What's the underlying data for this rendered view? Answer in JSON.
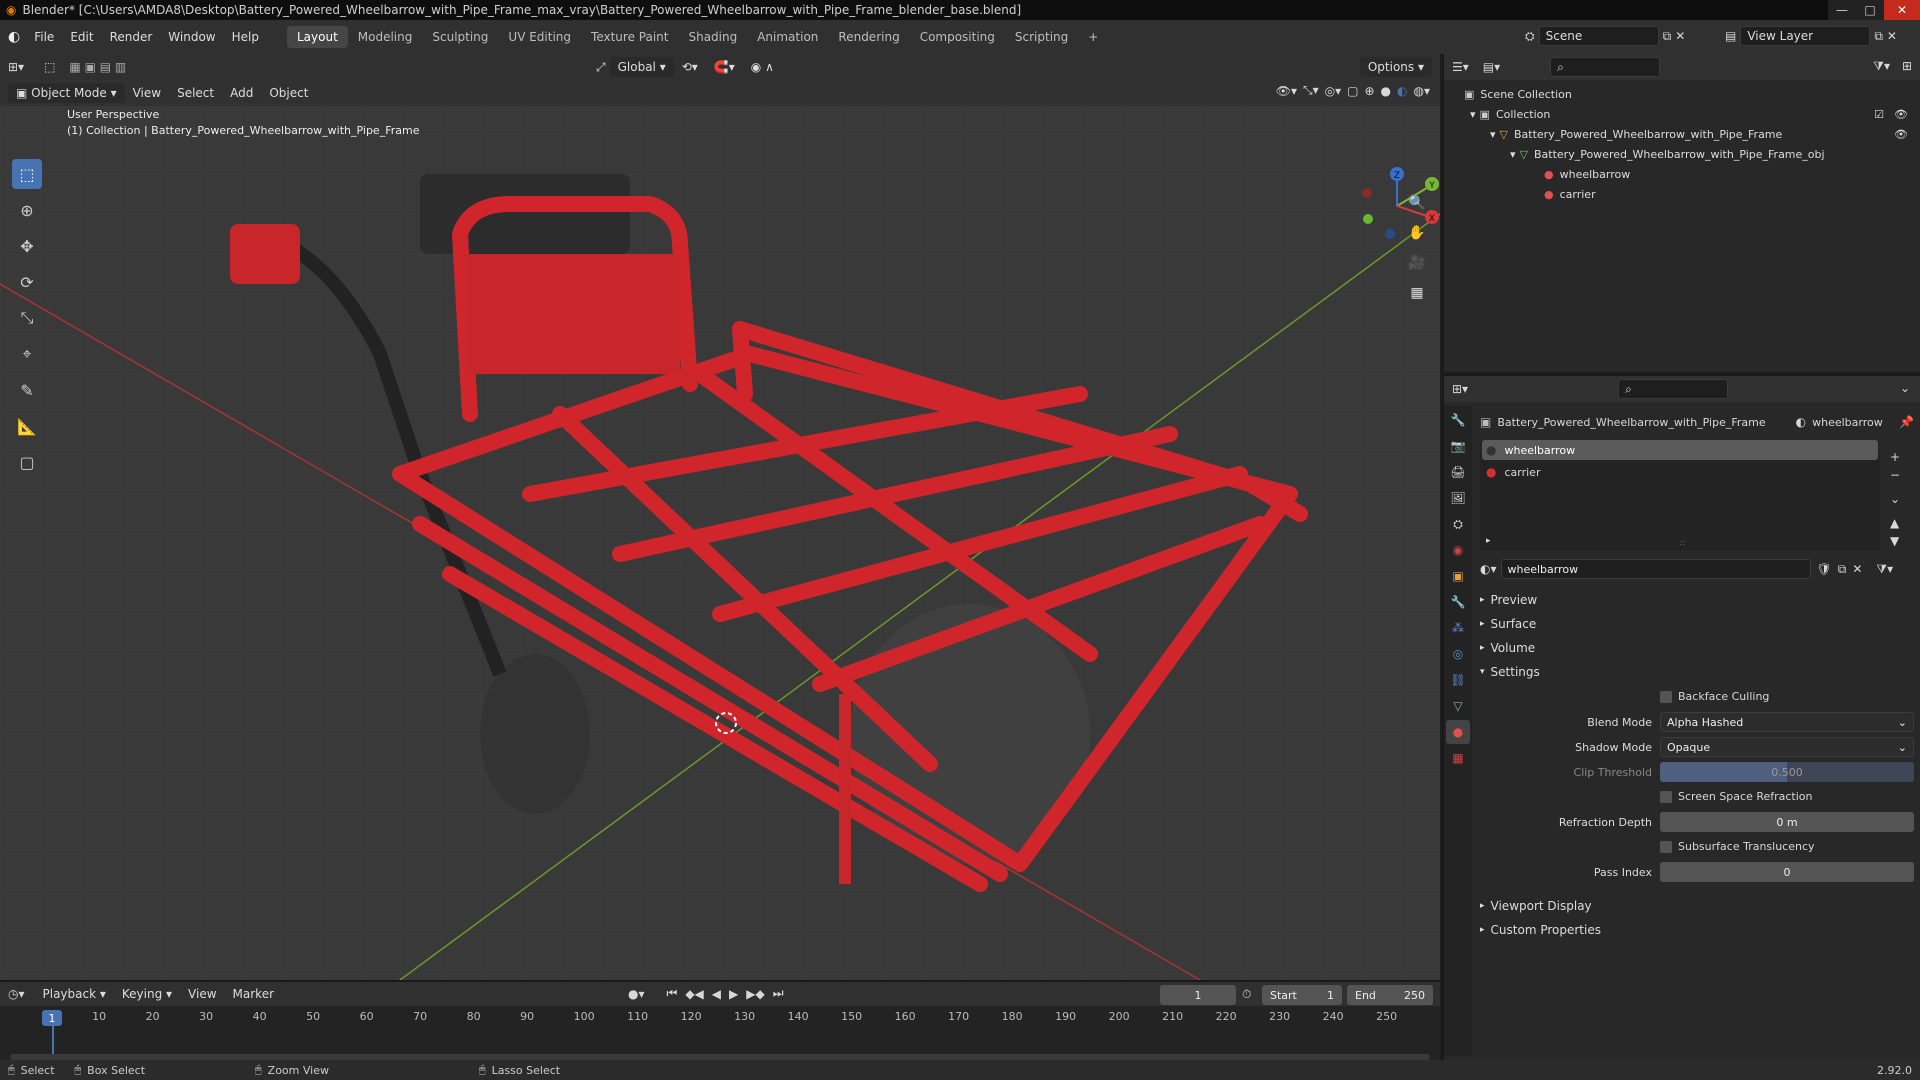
{
  "app": {
    "title": "Blender* [C:\\Users\\AMDA8\\Desktop\\Battery_Powered_Wheelbarrow_with_Pipe_Frame_max_vray\\Battery_Powered_Wheelbarrow_with_Pipe_Frame_blender_base.blend]",
    "version": "2.92.0"
  },
  "topbar": {
    "menus": [
      "File",
      "Edit",
      "Render",
      "Window",
      "Help"
    ],
    "workspaces": [
      "Layout",
      "Modeling",
      "Sculpting",
      "UV Editing",
      "Texture Paint",
      "Shading",
      "Animation",
      "Rendering",
      "Compositing",
      "Scripting"
    ],
    "active_workspace": "Layout",
    "scene": "Scene",
    "view_layer": "View Layer"
  },
  "viewport": {
    "mode": "Object Mode",
    "menus": [
      "View",
      "Select",
      "Add",
      "Object"
    ],
    "orientation": "Global",
    "options_label": "Options",
    "overlay_title": "User Perspective",
    "overlay_subtitle": "(1) Collection | Battery_Powered_Wheelbarrow_with_Pipe_Frame",
    "gizmo_axes": {
      "x": "X",
      "y": "Y",
      "z": "Z"
    }
  },
  "outliner": {
    "rows": [
      {
        "label": "Scene Collection",
        "depth": 0,
        "icon": "collection-icon"
      },
      {
        "label": "Collection",
        "depth": 1,
        "icon": "collection-icon"
      },
      {
        "label": "Battery_Powered_Wheelbarrow_with_Pipe_Frame",
        "depth": 2,
        "icon": "object-icon"
      },
      {
        "label": "Battery_Powered_Wheelbarrow_with_Pipe_Frame_obj",
        "depth": 3,
        "icon": "mesh-icon"
      },
      {
        "label": "wheelbarrow",
        "depth": 4,
        "icon": "material-icon"
      },
      {
        "label": "carrier",
        "depth": 4,
        "icon": "material-icon"
      }
    ]
  },
  "properties": {
    "object_name": "Battery_Powered_Wheelbarrow_with_Pipe_Frame",
    "material_name": "wheelbarrow",
    "slots": [
      "wheelbarrow",
      "carrier"
    ],
    "material_field": "wheelbarrow",
    "panels": [
      "Preview",
      "Surface",
      "Volume",
      "Settings"
    ],
    "settings": {
      "backface_culling": "Backface Culling",
      "blend_mode_label": "Blend Mode",
      "blend_mode": "Alpha Hashed",
      "shadow_mode_label": "Shadow Mode",
      "shadow_mode": "Opaque",
      "clip_threshold_label": "Clip Threshold",
      "clip_threshold": "0.500",
      "ssr": "Screen Space Refraction",
      "refraction_depth_label": "Refraction Depth",
      "refraction_depth": "0 m",
      "subsurface": "Subsurface Translucency",
      "pass_index_label": "Pass Index",
      "pass_index": "0"
    },
    "bottom_panels": [
      "Viewport Display",
      "Custom Properties"
    ]
  },
  "timeline": {
    "menus": [
      "Playback",
      "Keying",
      "View",
      "Marker"
    ],
    "current_frame": "1",
    "start_label": "Start",
    "start": "1",
    "end_label": "End",
    "end": "250",
    "ticks": [
      "1",
      "10",
      "20",
      "30",
      "40",
      "50",
      "60",
      "70",
      "80",
      "90",
      "100",
      "110",
      "120",
      "130",
      "140",
      "150",
      "160",
      "170",
      "180",
      "190",
      "200",
      "210",
      "220",
      "230",
      "240",
      "250"
    ]
  },
  "statusbar": {
    "select": "Select",
    "box_select": "Box Select",
    "zoom_view": "Zoom View",
    "lasso_select": "Lasso Select"
  },
  "colors": {
    "accent": "#4772b3",
    "frame_red": "#d0262b",
    "grid": "#3a3a3a"
  }
}
